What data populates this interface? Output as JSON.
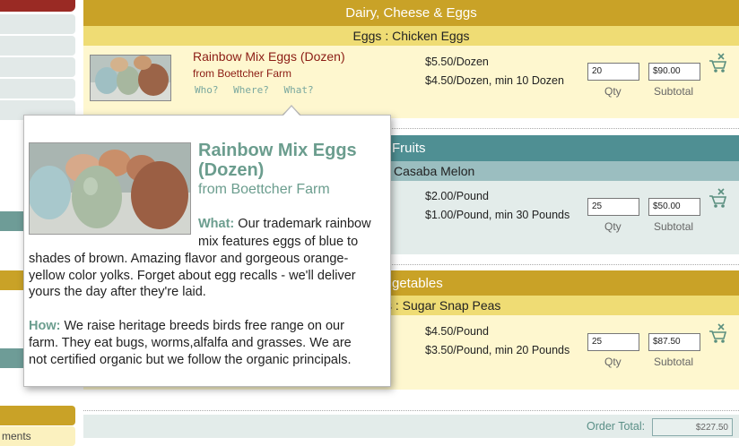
{
  "sidebar": {
    "label_bottom": "ments"
  },
  "categories": [
    {
      "title": "Dairy, Cheese & Eggs",
      "subtitle": "Eggs : Chicken Eggs",
      "product": {
        "name": "Rainbow Mix Eggs (Dozen)",
        "farm": "from Boettcher Farm",
        "links": [
          "Who?",
          "Where?",
          "What?"
        ],
        "price1": "$5.50/Dozen",
        "price2": "$4.50/Dozen, min 10 Dozen",
        "qty": "20",
        "subtotal": "$90.00"
      }
    },
    {
      "title": "Fruits",
      "subtitle": "Casaba Melon",
      "product": {
        "price1": "$2.00/Pound",
        "price2": "$1.00/Pound, min 30 Pounds",
        "qty": "25",
        "subtotal": "$50.00"
      }
    },
    {
      "title": "getables",
      "subtitle": "s : Sugar Snap Peas",
      "product": {
        "price1": "$4.50/Pound",
        "price2": "$3.50/Pound, min 20 Pounds",
        "qty": "25",
        "subtotal": "$87.50"
      }
    }
  ],
  "labels": {
    "qty": "Qty",
    "subtotal": "Subtotal"
  },
  "order": {
    "total_label": "Order Total:",
    "total_value": "$227.50"
  },
  "popup": {
    "title": "Rainbow Mix Eggs (Dozen)",
    "farm": "from Boettcher Farm",
    "what_label": "What:",
    "what_text_1": "Our trademark rainbow",
    "what_text_2": "mix features eggs of blue to",
    "what_text_3": "shades of brown. Amazing flavor and gorgeous orange-",
    "what_text_4": "yellow color yolks. Forget about egg recalls - we'll deliver",
    "what_text_5": "yours the day after they're laid.",
    "how_label": "How:",
    "how_text_1": "We raise heritage breeds birds free range on our",
    "how_text_2": "farm. They eat bugs, worms,alfalfa and grasses. We are",
    "how_text_3": "not certified organic but we follow the organic principals."
  },
  "colors": {
    "gold": "#c9a227",
    "teal": "#4f8f93",
    "accent_green": "#6b9d8e",
    "product_red": "#8b1c14"
  }
}
